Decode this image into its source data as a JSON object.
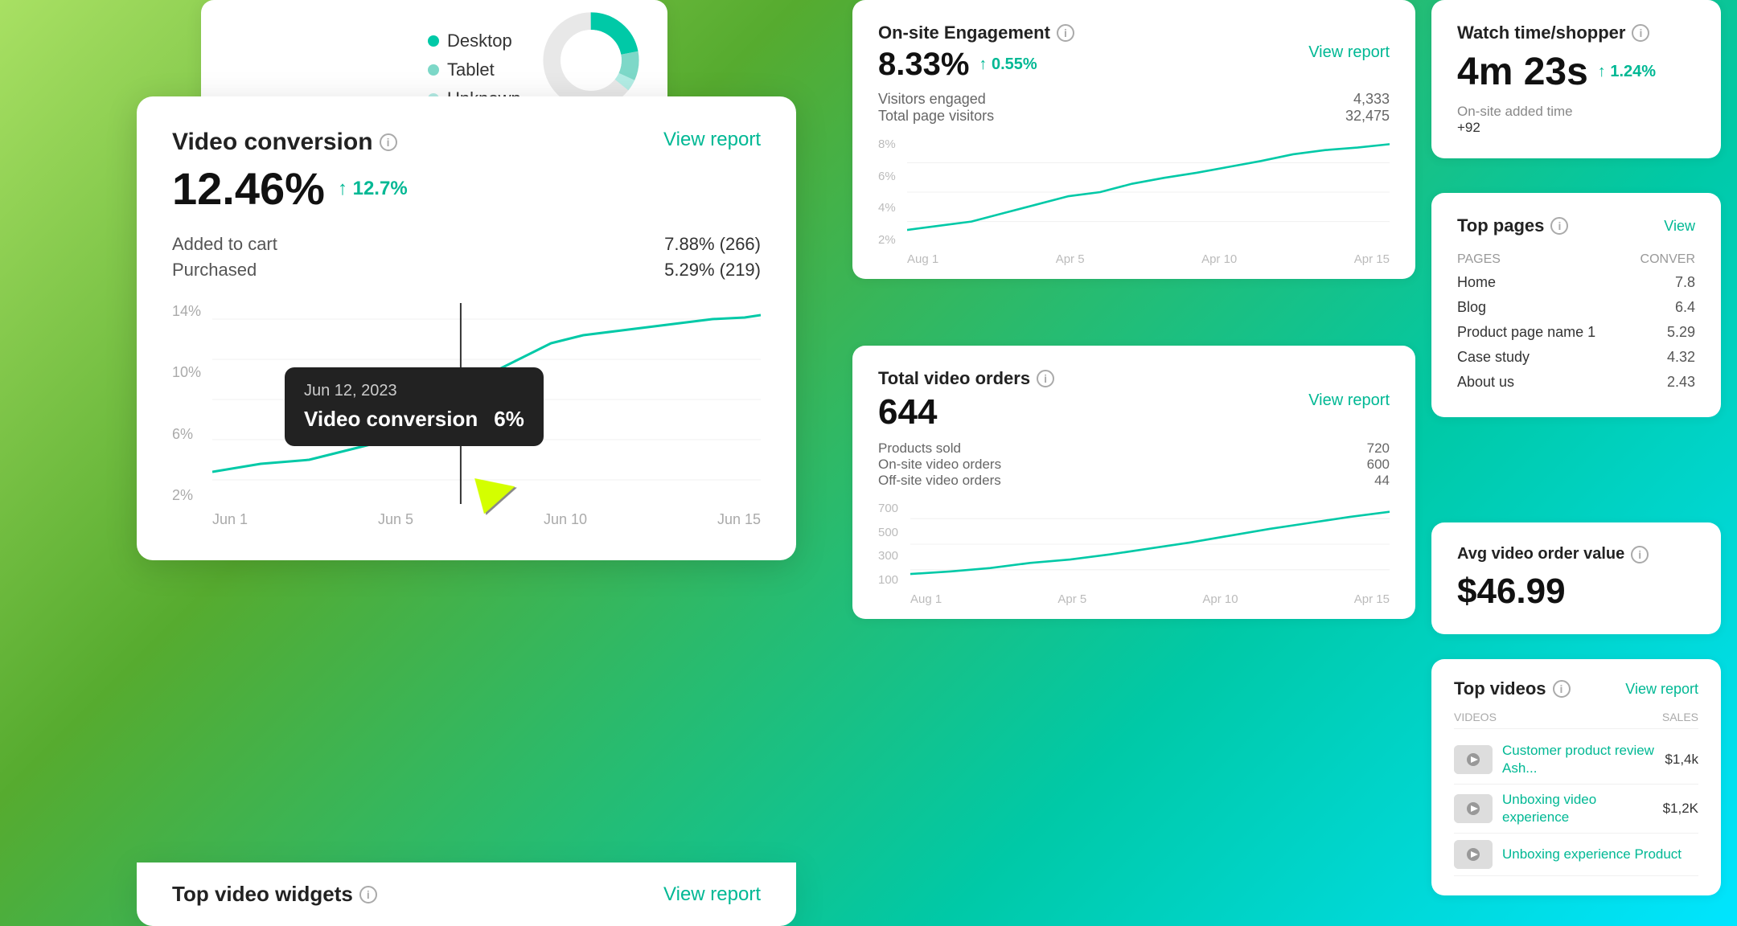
{
  "device_card": {
    "items": [
      {
        "label": "Desktop",
        "pct": "22%",
        "color": "#00c9a7"
      },
      {
        "label": "Tablet",
        "pct": "10%",
        "color": "#7dd8c8"
      },
      {
        "label": "Unknown",
        "pct": "4%",
        "color": "#b2ece4"
      }
    ]
  },
  "video_conversion": {
    "title": "Video conversion",
    "view_report": "View report",
    "metric": "12.46%",
    "change": "↑ 12.7%",
    "rows": [
      {
        "label": "Added to cart",
        "value": "7.88% (266)"
      },
      {
        "label": "Purchased",
        "value": "5.29% (219)"
      }
    ],
    "chart": {
      "y_labels": [
        "14%",
        "10%",
        "6%",
        "2%"
      ],
      "x_labels": [
        "Jun 1",
        "Jun 5",
        "Jun 10",
        "Jun 15"
      ]
    },
    "tooltip": {
      "date": "Jun 12, 2023",
      "label": "Video conversion",
      "value": "6%"
    }
  },
  "engagement": {
    "title": "On-site Engagement",
    "view_report": "View report",
    "metric": "8.33%",
    "change": "↑ 0.55%",
    "rows": [
      {
        "label": "Visitors engaged",
        "value": "4,333"
      },
      {
        "label": "Total page visitors",
        "value": "32,475"
      }
    ],
    "chart": {
      "y_labels": [
        "8%",
        "6%",
        "4%",
        "2%"
      ],
      "x_labels": [
        "Aug 1",
        "Apr 5",
        "Apr 10",
        "Apr 15"
      ]
    }
  },
  "total_video_orders": {
    "title": "Total video orders",
    "view_report": "View report",
    "metric": "644",
    "rows": [
      {
        "label": "Products sold",
        "value": "720"
      },
      {
        "label": "On-site video orders",
        "value": "600"
      },
      {
        "label": "Off-site video orders",
        "value": "44"
      }
    ],
    "chart": {
      "y_labels": [
        "700",
        "500",
        "300",
        "100"
      ],
      "x_labels": [
        "Aug 1",
        "Apr 5",
        "Apr 10",
        "Apr 15"
      ]
    }
  },
  "watch_time": {
    "title": "Watch time/shopper",
    "metric": "4m 23s",
    "change": "↑ 1.24%",
    "label": "On-site added time",
    "value": "+92"
  },
  "top_pages": {
    "title": "Top pages",
    "view_label": "View",
    "columns": [
      "PAGES",
      "CONVER"
    ],
    "rows": [
      {
        "page": "Home",
        "value": "7.8"
      },
      {
        "page": "Blog",
        "value": "6.4"
      },
      {
        "page": "Product page name 1",
        "value": "5.29"
      },
      {
        "page": "Case study",
        "value": "4.32"
      },
      {
        "page": "About us",
        "value": "2.43"
      }
    ]
  },
  "avg_order_value": {
    "title": "Avg video order value",
    "metric": "$46.99"
  },
  "top_videos": {
    "title": "Top videos",
    "view_report": "View report",
    "columns": [
      "VIDEOS",
      "SALES"
    ],
    "items": [
      {
        "title": "Customer product review Ash...",
        "sales": "$1,4k"
      },
      {
        "title": "Unboxing video experience",
        "sales": "$1,2K"
      },
      {
        "title": "Unboxing experience Product",
        "sales": ""
      }
    ]
  },
  "bottom_widget": {
    "title": "Top video widgets",
    "view_report": "View report"
  }
}
